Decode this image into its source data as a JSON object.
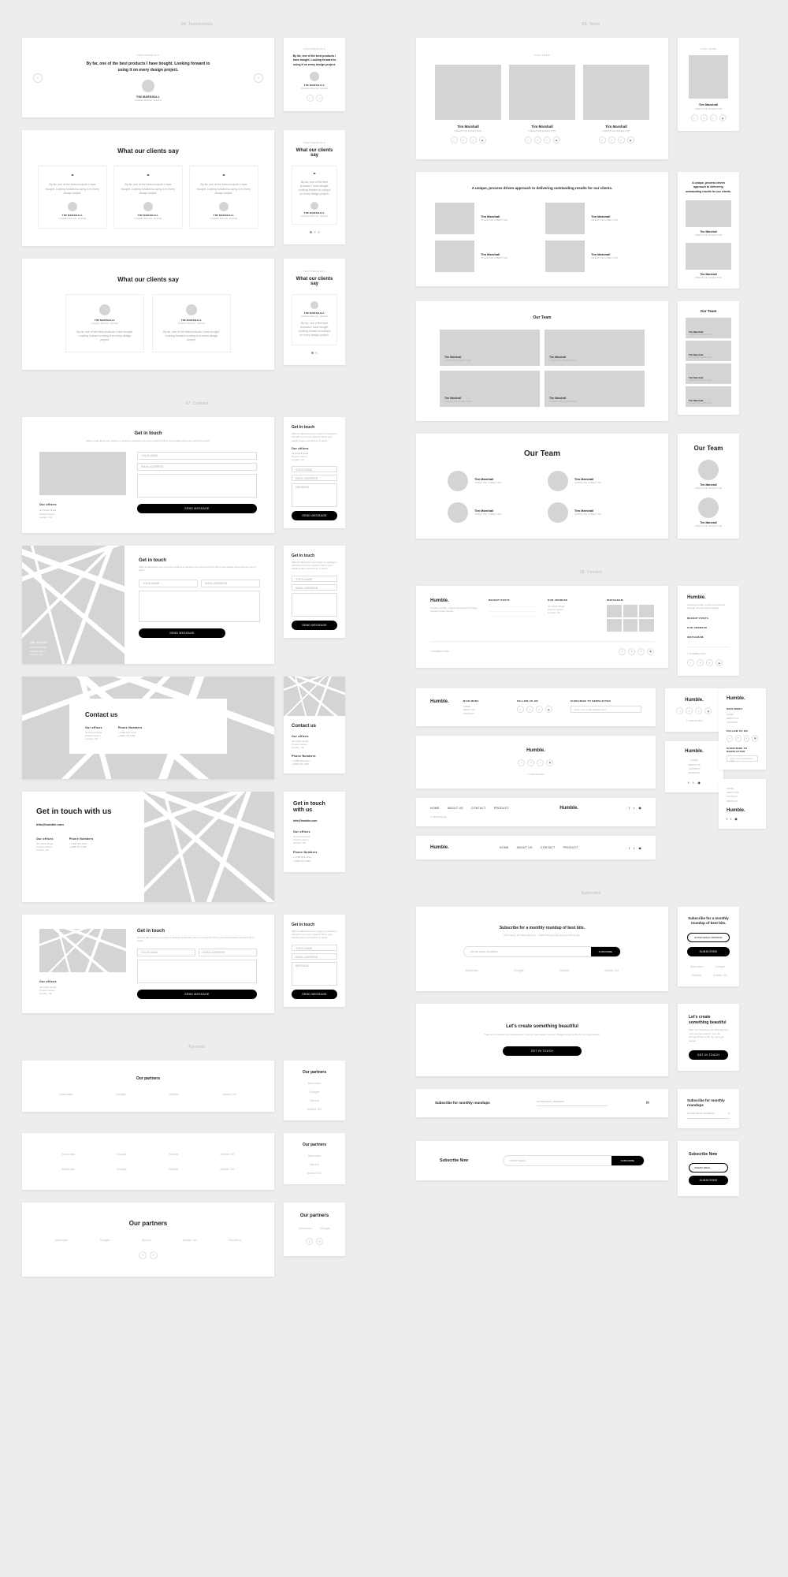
{
  "labels": {
    "testimonials": "04. Testimonials",
    "team": "06. Team",
    "contact": "07. Contact",
    "footers": "08. Footers",
    "subscribe": "Subscribe",
    "partners": "Partners"
  },
  "testimonials": {
    "eyebrow": "TESTIMONIALS",
    "quote": "By far, one of the best products I have bought. Looking forward to using it on every design project.",
    "quote_sm": "By far, one of the best products I have bought. Looking forward to using it on every design project.",
    "name": "TIM MARSHALL",
    "role": "Creative Director, Humble",
    "heading": "What our clients say"
  },
  "team": {
    "eyebrow": "OUR TEAM",
    "name": "Tim Marshall",
    "role": "CREATIVE DIRECTOR",
    "intro": "A unique, process driven approach to delivering outstanding results for our clients.",
    "heading_sm": "Our Team",
    "heading_lg": "Our Team"
  },
  "contact": {
    "heading_sm": "Get in touch",
    "heading_lg": "Contact us",
    "heading_xl": "Get in touch with us",
    "desc": "Want to talk about your project or arrange a call with one of our experts? Fill in your details below and we'll be in touch.",
    "offices_label": "Our offices",
    "address1": "42 Oxford Road",
    "address2": "Preston Green",
    "address3": "London, UK",
    "phone_label": "Phone Numbers",
    "phone1": "+1 888 343-4343",
    "phone2": "+1888 337-1380",
    "email": "info@humble.com",
    "ph_name": "YOUR NAME",
    "ph_email": "EMAIL ADDRESS",
    "ph_message": "MESSAGE",
    "send": "SEND MESSAGE"
  },
  "footer": {
    "brand": "Humble.",
    "brand_desc": "Creating simple, unique experiences through process driven design.",
    "col_posts": "RECENT POSTS",
    "col_address": "OUR ADDRESS",
    "col_instagram": "INSTAGRAM",
    "copyright": "© HUMBLE.COM",
    "menu1": "MAIN MENU",
    "link_home": "HOME",
    "link_about": "ABOUT US",
    "link_contact": "CONTACT",
    "link_product": "PRODUCT",
    "follow": "FOLLOW US ON",
    "newsletter": "SUBSCRIBE TO NEWSLETTER",
    "email_ph": "Enter your email address here",
    "copy2": "© 2019 Humble"
  },
  "subscribe": {
    "heading": "Subscribe for a monthly roundup of best bits.",
    "desc": "Don't worry, we hate spam too — that's why we only send you the goods.",
    "email_ph": "ENTER EMAIL ADDRESS",
    "btn": "SUBSCRIBE",
    "logos": [
      "Macrotax",
      "Google",
      "Sketch",
      "Adobe XD"
    ],
    "cta_heading": "Let's create something beautiful",
    "cta_desc": "Take our interactive tour and discover more and get started. You can change things on the fly. Let's get started.",
    "cta_btn": "GET IN TOUCH",
    "heading2": "Subscribe for monthly roundups",
    "heading3": "Subscribe Now",
    "email_ph2": "INSERT EMAIL"
  },
  "partners": {
    "heading": "Our partners",
    "logos": [
      "Macrotax",
      "Google",
      "Sketch",
      "Adobe XD",
      "Rockfirm"
    ]
  }
}
